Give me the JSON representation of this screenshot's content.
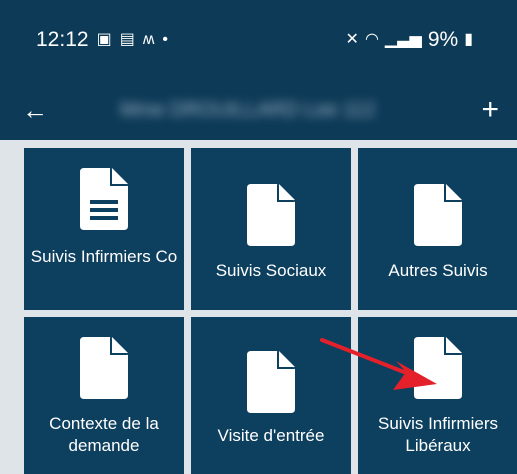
{
  "status_bar": {
    "time": "12:12",
    "battery": "9%",
    "icons_left": [
      "gallery-icon",
      "sim-icon",
      "signal-app-icon",
      "dot-icon"
    ],
    "icons_right": [
      "mute-icon",
      "wifi-icon",
      "cell-signal-icon",
      "battery-icon"
    ]
  },
  "app_bar": {
    "title": "Mme DROUILLARD Lee 112",
    "back_icon": "arrow-left-icon",
    "add_label": "+"
  },
  "tiles": [
    {
      "label": "Suivis Infirmiers Co",
      "icon": "document-lines-icon"
    },
    {
      "label": "Suivis Sociaux",
      "icon": "document-icon"
    },
    {
      "label": "Autres Suivis",
      "icon": "document-icon"
    },
    {
      "label": "Contexte de la demande",
      "icon": "document-icon"
    },
    {
      "label": "Visite d'entrée",
      "icon": "document-icon"
    },
    {
      "label": "Suivis Infirmiers Libéraux",
      "icon": "document-icon"
    }
  ],
  "colors": {
    "header": "#0d3a57",
    "tile": "#0d3f5f",
    "annotation_arrow": "#e4202a"
  }
}
